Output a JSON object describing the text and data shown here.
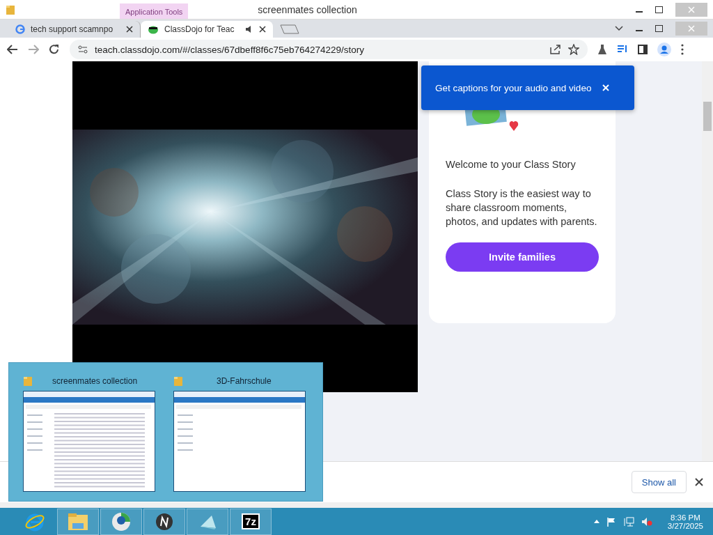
{
  "explorer_bar": {
    "context_tab": "Application Tools",
    "title": "screenmates collection"
  },
  "tabs": [
    {
      "title": "tech support scamnpo",
      "selected": false,
      "audio": false,
      "kind": "google"
    },
    {
      "title": "ClassDojo for Teac",
      "selected": true,
      "audio": true,
      "kind": "dojo"
    }
  ],
  "address": {
    "url": "teach.classdojo.com/#/classes/67dbeff8f6c75eb764274229/story"
  },
  "caption_tip": {
    "text": "Get captions for your audio and video"
  },
  "story_card": {
    "heading": "Welcome to your Class Story",
    "body": "Class Story is the easiest way to share classroom moments, photos, and updates with parents.",
    "button": "Invite families"
  },
  "download_bar": {
    "button": "Show all"
  },
  "thumbnails": [
    {
      "title": "screenmates collection",
      "kind": "full"
    },
    {
      "title": "3D-Fahrschule",
      "kind": "empty"
    }
  ],
  "taskbar": {
    "apps": [
      {
        "kind": "ie",
        "running": false
      },
      {
        "kind": "explorer",
        "running": true
      },
      {
        "kind": "chrome",
        "running": true
      },
      {
        "kind": "n",
        "running": true
      },
      {
        "kind": "note",
        "running": true
      },
      {
        "kind": "zip",
        "running": true,
        "label": "7z"
      }
    ],
    "clock": {
      "time": "8:36 PM",
      "date": "3/27/2025"
    }
  }
}
